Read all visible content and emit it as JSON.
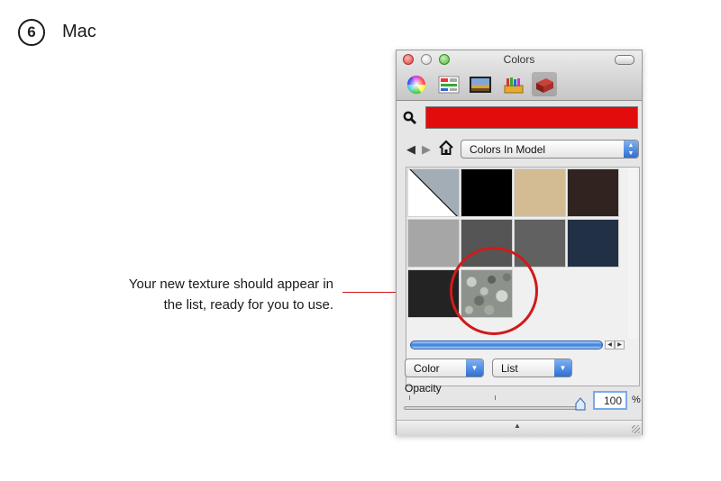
{
  "step": {
    "number": "6",
    "title": "Mac"
  },
  "callout": {
    "line1": "Your new texture should appear in",
    "line2": "the list, ready for you to use.",
    "color": "#d11a1a"
  },
  "window": {
    "title": "Colors",
    "modes": [
      "color-wheel-icon",
      "color-sliders-icon",
      "image-palette-icon",
      "crayons-icon",
      "materials-brick-icon"
    ],
    "active_mode": "materials-brick-icon"
  },
  "current_color": "#e20c0c",
  "library": {
    "selected": "Colors In Model"
  },
  "swatches": {
    "row1": [
      "#a2adb6",
      "#000000",
      "#d3bc93",
      "#302320"
    ],
    "row2": [
      "#a6a6a6",
      "#555555",
      "#616161",
      "#223045"
    ],
    "row3": [
      "#232323",
      "texture"
    ]
  },
  "filters": {
    "type_value": "Color",
    "view_value": "List"
  },
  "opacity": {
    "label": "Opacity",
    "value": "100",
    "unit": "%"
  }
}
